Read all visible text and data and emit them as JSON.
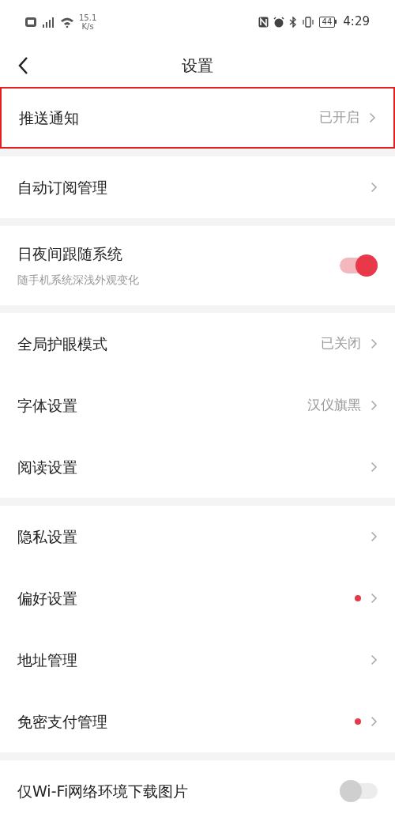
{
  "status_bar": {
    "net_speed": "15.1",
    "net_unit": "K/s",
    "battery": "44",
    "time": "4:29"
  },
  "title": "设置",
  "groups": [
    {
      "items": [
        {
          "kind": "link",
          "label": "推送通知",
          "value": "已开启",
          "dot": false,
          "highlighted": true
        }
      ]
    },
    {
      "items": [
        {
          "kind": "link",
          "label": "自动订阅管理",
          "dot": false,
          "highlighted": false
        }
      ]
    },
    {
      "items": [
        {
          "kind": "toggle",
          "label": "日夜间跟随系统",
          "subtitle": "随手机系统深浅外观变化",
          "on": true,
          "highlighted": false
        }
      ]
    },
    {
      "items": [
        {
          "kind": "link",
          "label": "全局护眼模式",
          "value": "已关闭",
          "dot": false,
          "highlighted": false
        },
        {
          "kind": "link",
          "label": "字体设置",
          "value": "汉仪旗黑",
          "dot": false,
          "highlighted": false
        },
        {
          "kind": "link",
          "label": "阅读设置",
          "dot": false,
          "highlighted": false
        }
      ]
    },
    {
      "items": [
        {
          "kind": "link",
          "label": "隐私设置",
          "dot": false,
          "highlighted": false
        },
        {
          "kind": "link",
          "label": "偏好设置",
          "dot": true,
          "highlighted": false
        },
        {
          "kind": "link",
          "label": "地址管理",
          "dot": false,
          "highlighted": false
        },
        {
          "kind": "link",
          "label": "免密支付管理",
          "dot": true,
          "highlighted": false
        }
      ]
    },
    {
      "items": [
        {
          "kind": "toggle",
          "label": "仅Wi-Fi网络环境下载图片",
          "on": false,
          "highlighted": false
        }
      ]
    }
  ]
}
